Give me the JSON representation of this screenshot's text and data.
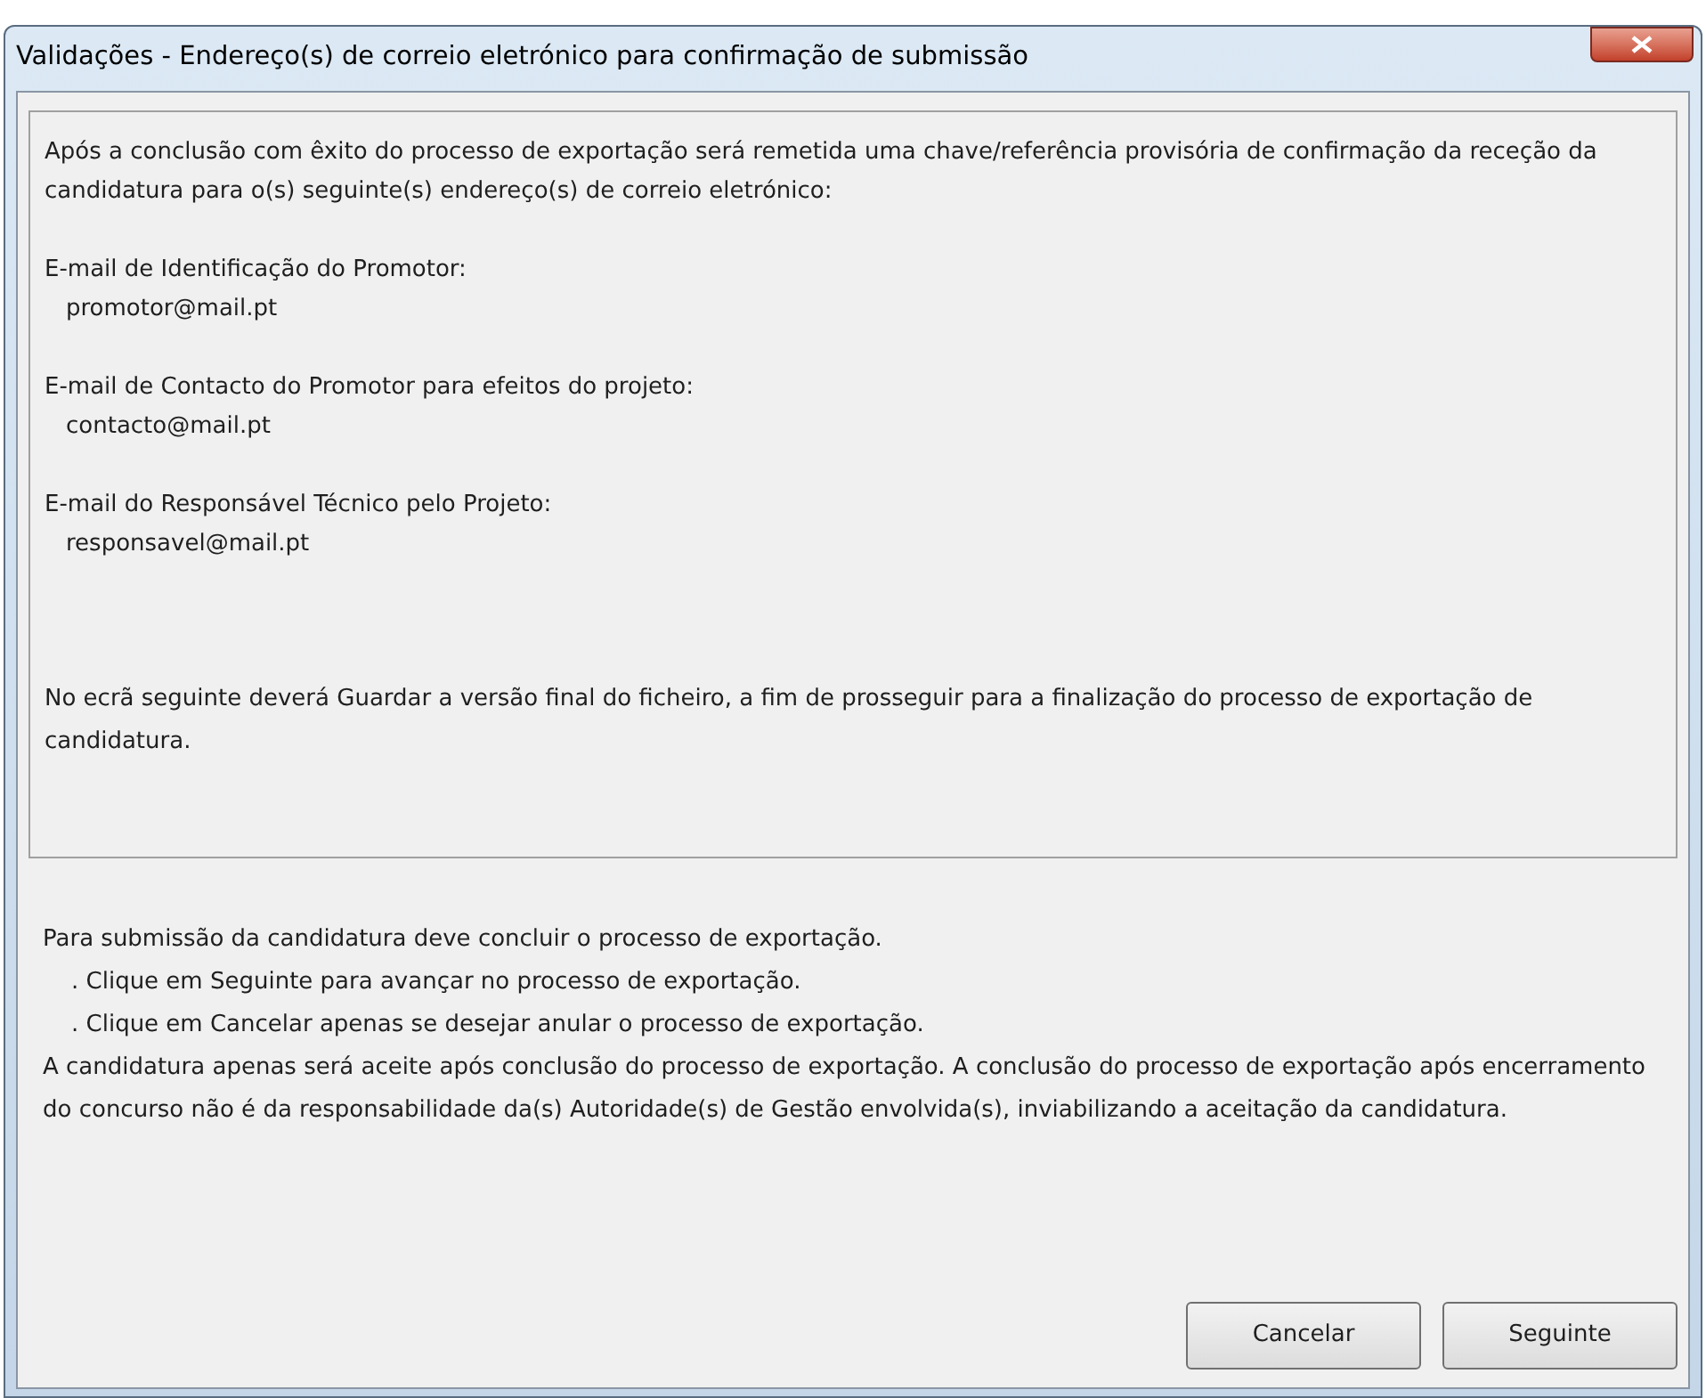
{
  "window": {
    "title": "Validações - Endereço(s) de correio eletrónico para confirmação de submissão"
  },
  "panel": {
    "intro": "Após a conclusão com êxito do processo de exportação será remetida uma chave/referência provisória de confirmação da receção da candidatura para o(s) seguinte(s) endereço(s) de correio eletrónico:",
    "emails": [
      {
        "label": "E-mail de Identificação do Promotor:",
        "value": "promotor@mail.pt"
      },
      {
        "label": "E-mail de Contacto do Promotor para efeitos do projeto:",
        "value": "contacto@mail.pt"
      },
      {
        "label": "E-mail do Responsável Técnico pelo Projeto:",
        "value": "responsavel@mail.pt"
      }
    ],
    "note": "No ecrã seguinte deverá Guardar a versão final do ficheiro, a fim de prosseguir para a finalização do processo de exportação de candidatura."
  },
  "instructions": [
    {
      "kind": "line",
      "text": "Para submissão da candidatura deve concluir o processo de exportação."
    },
    {
      "kind": "step",
      "text": ". Clique em Seguinte para avançar no processo de exportação."
    },
    {
      "kind": "step",
      "text": ". Clique em Cancelar apenas se desejar anular o processo de exportação."
    },
    {
      "kind": "line",
      "text": "A candidatura apenas será aceite após conclusão do processo de exportação. A conclusão do processo de exportação após encerramento do concurso não é da responsabilidade da(s) Autoridade(s) de Gestão envolvida(s), inviabilizando a aceitação da candidatura."
    }
  ],
  "buttons": [
    "Cancelar",
    "Seguinte"
  ]
}
